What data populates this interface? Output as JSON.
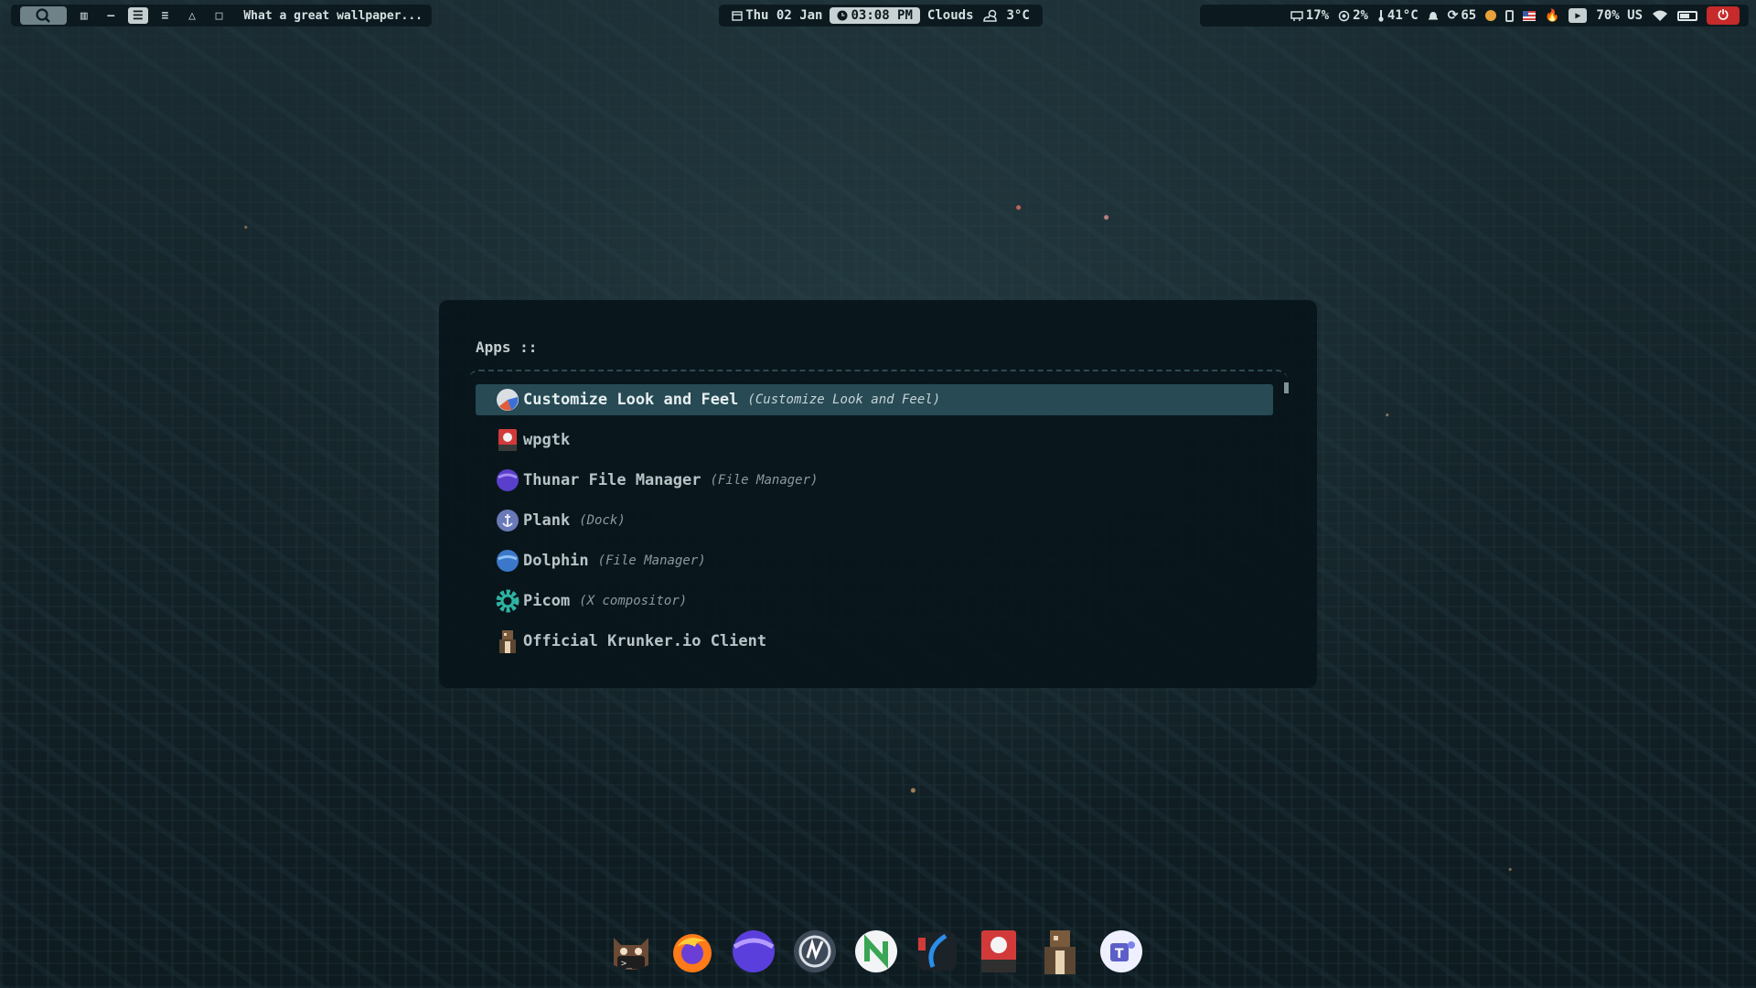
{
  "topbar": {
    "left": {
      "launcher_icon": "arch-search-icon",
      "workspaces": [
        "▥",
        "–",
        "☰",
        "≡",
        "△",
        "□"
      ],
      "active_workspace": 2,
      "window_title": "What a great wallpaper..."
    },
    "center": {
      "date": "Thu 02 Jan",
      "time": "03:08 PM",
      "weather": "Clouds",
      "temperature": "3°C"
    },
    "right": {
      "memory": "17%",
      "cpu": "2%",
      "cpu_temp": "41°C",
      "updates": "65",
      "volume_keyboard": "70% US",
      "battery_level": 0.55
    },
    "colors": {
      "bar_bg": "#0c1a1f",
      "power": "#c62a2a",
      "clock_bg": "#c8d1d3"
    }
  },
  "launcher": {
    "prompt": "Apps ::",
    "selected_index": 0,
    "entries": [
      {
        "name": "Customize Look and Feel",
        "desc": "(Customize Look and Feel)",
        "icon": "look-and-feel-icon"
      },
      {
        "name": "wpgtk",
        "desc": "",
        "icon": "wpgtk-icon"
      },
      {
        "name": "Thunar File Manager",
        "desc": "(File Manager)",
        "icon": "thunar-icon"
      },
      {
        "name": "Plank",
        "desc": "(Dock)",
        "icon": "plank-anchor-icon"
      },
      {
        "name": "Dolphin",
        "desc": "(File Manager)",
        "icon": "dolphin-icon"
      },
      {
        "name": "Picom",
        "desc": "(X compositor)",
        "icon": "picom-gear-icon"
      },
      {
        "name": "Official Krunker.io Client",
        "desc": "",
        "icon": "krunker-icon"
      }
    ],
    "colors": {
      "bg": "#08141a",
      "selected": "#274a54"
    }
  },
  "dock": {
    "items": [
      {
        "name": "terminal",
        "icon": "terminal-cat-icon"
      },
      {
        "name": "firefox",
        "icon": "firefox-icon"
      },
      {
        "name": "file-manager",
        "icon": "purple-folder-icon"
      },
      {
        "name": "lutris",
        "icon": "lutris-icon"
      },
      {
        "name": "neovim",
        "icon": "neovim-icon"
      },
      {
        "name": "osu",
        "icon": "swoosh-icon"
      },
      {
        "name": "wpgtk",
        "icon": "wpgtk-icon"
      },
      {
        "name": "krunker",
        "icon": "krunker-icon"
      },
      {
        "name": "teams",
        "icon": "teams-icon"
      }
    ]
  }
}
